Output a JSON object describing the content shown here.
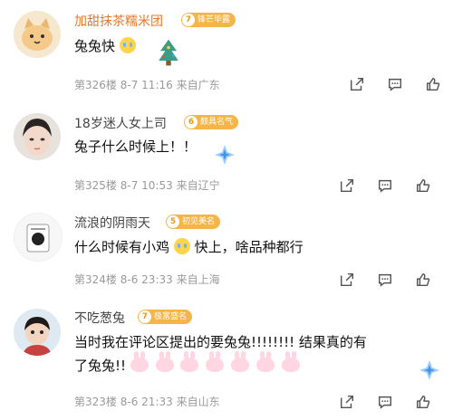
{
  "comments": [
    {
      "username": "加甜抹茶糯米团",
      "badge_level": "7",
      "badge_label": "锋芒毕露",
      "text": "兔兔快",
      "floor": "第326楼",
      "date": "8-7",
      "time": "11:16",
      "location": "来自广东"
    },
    {
      "username": "18岁迷人女上司",
      "badge_level": "6",
      "badge_label": "颇具名气",
      "text": "兔子什么时候上！！",
      "floor": "第325楼",
      "date": "8-7",
      "time": "10:53",
      "location": "来自辽宁"
    },
    {
      "username": "流浪的阴雨天",
      "badge_level": "5",
      "badge_label": "初见美名",
      "text_part1": "什么时候有小鸡",
      "text_part2": "快上，啥品种都行",
      "floor": "第324楼",
      "date": "8-6",
      "time": "23:33",
      "location": "来自上海"
    },
    {
      "username": "不吃葱兔",
      "badge_level": "7",
      "badge_label": "极富盛名",
      "text_line1": "当时我在评论区提出的要兔兔!!!!!!!! 结果真的有",
      "text_line2": "了兔兔!!",
      "floor": "第323楼",
      "date": "8-6",
      "time": "21:33",
      "location": "来自山东"
    }
  ],
  "icons": {
    "share": "share-icon",
    "reply": "comment-icon",
    "like": "thumbs-up-icon"
  },
  "colors": {
    "badge": "#f5b547",
    "meta": "#9a9a9a"
  }
}
